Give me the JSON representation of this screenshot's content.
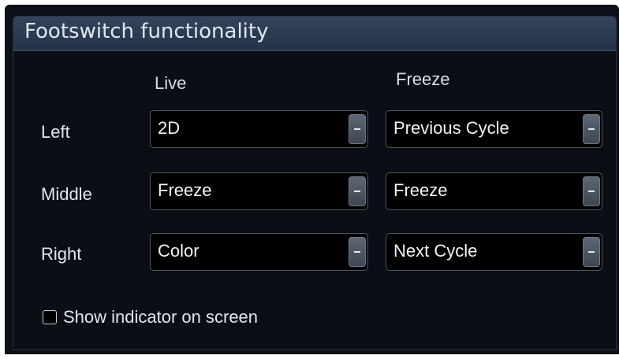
{
  "panel": {
    "title": "Footswitch functionality"
  },
  "columns": {
    "live": "Live",
    "freeze": "Freeze"
  },
  "rows": [
    {
      "label": "Left",
      "live_value": "2D",
      "freeze_value": "Previous Cycle"
    },
    {
      "label": "Middle",
      "live_value": "Freeze",
      "freeze_value": "Freeze"
    },
    {
      "label": "Right",
      "live_value": "Color",
      "freeze_value": "Next Cycle"
    }
  ],
  "indicator": {
    "label": "Show indicator on screen",
    "checked": false
  },
  "colors": {
    "background": "#0b0e14",
    "header": "#2b3a50",
    "text": "#e3e7ed"
  }
}
